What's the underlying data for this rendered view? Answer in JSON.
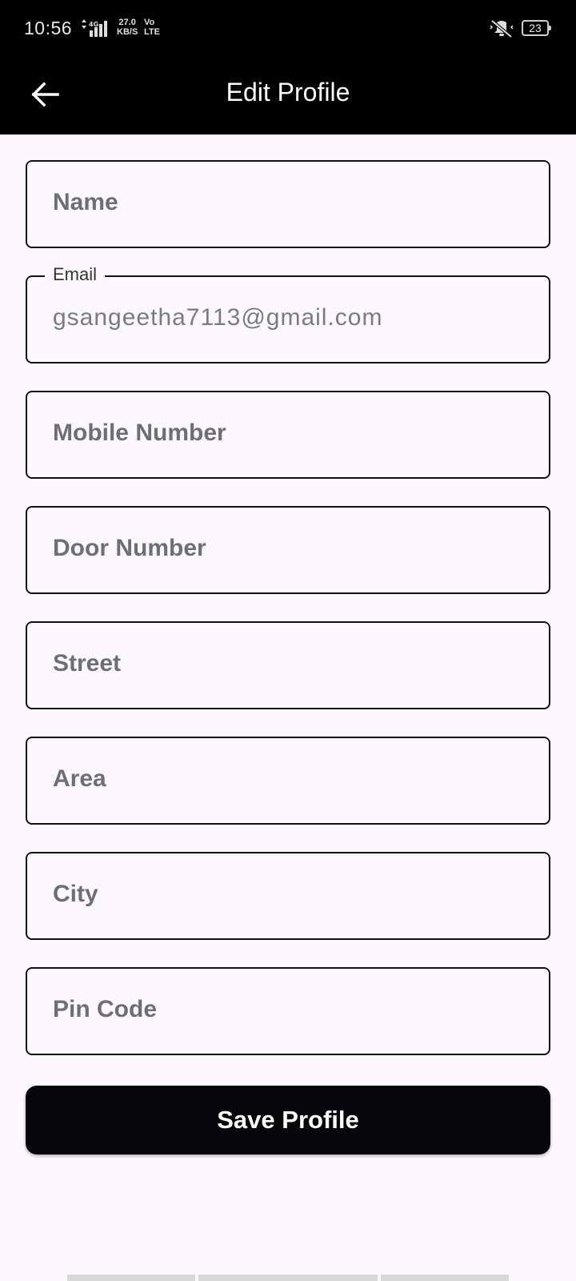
{
  "status_bar": {
    "time": "10:56",
    "speed_line1": "27.0",
    "speed_line2": "KB/S",
    "volte_line1": "Vo",
    "volte_line2": "LTE",
    "battery": "23",
    "icons": [
      "signal-icon",
      "mute-icon",
      "battery-icon"
    ]
  },
  "app_bar": {
    "title": "Edit Profile",
    "back_icon": "arrow-back-icon"
  },
  "form": {
    "name": {
      "placeholder": "Name"
    },
    "email": {
      "label": "Email",
      "value": "gsangeetha7113@gmail.com"
    },
    "mobile": {
      "placeholder": "Mobile Number"
    },
    "door": {
      "placeholder": "Door Number"
    },
    "street": {
      "placeholder": "Street"
    },
    "area": {
      "placeholder": "Area"
    },
    "city": {
      "placeholder": "City"
    },
    "pincode": {
      "placeholder": "Pin Code"
    }
  },
  "actions": {
    "save_label": "Save Profile"
  },
  "colors": {
    "background": "#fdf8fd",
    "app_bar": "#000000",
    "button": "#06050a",
    "border": "#111111"
  }
}
